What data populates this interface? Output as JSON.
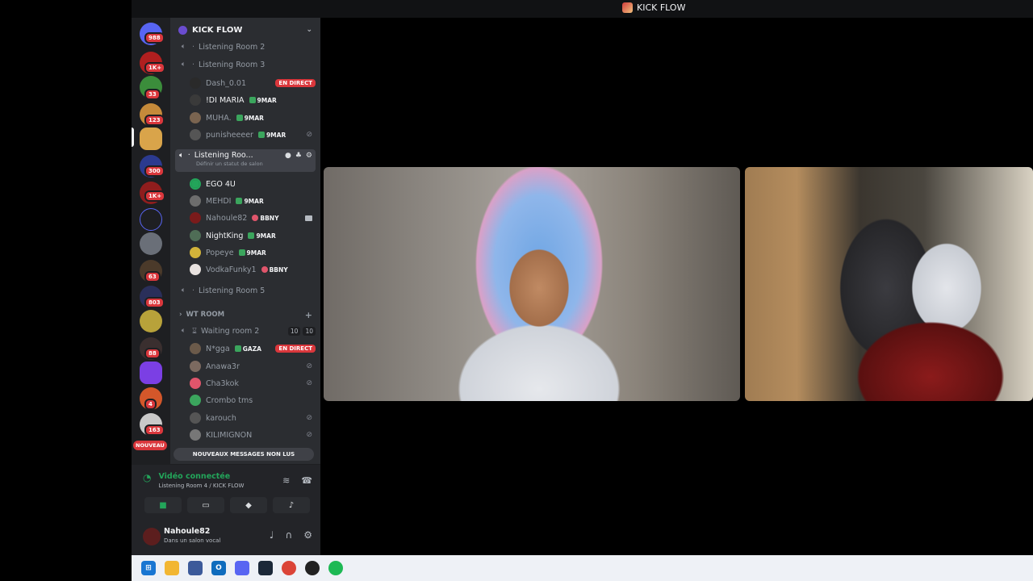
{
  "window": {
    "title": "KICK FLOW"
  },
  "rail": {
    "badges": [
      "988",
      "1K+",
      "33",
      "123",
      "300",
      "1K+",
      "63",
      "803",
      "88",
      "4",
      "163"
    ],
    "new_label": "NOUVEAU"
  },
  "guild": {
    "name": "KICK FLOW"
  },
  "channels": {
    "listening2": "Listening Room 2",
    "listening3": "Listening Room 3",
    "room3_users": [
      {
        "name": "Dash_0.01",
        "live": "EN DIRECT"
      },
      {
        "name": "!DI MARIA",
        "tag": "9MAR"
      },
      {
        "name": "MUHA.",
        "tag": "9MAR"
      },
      {
        "name": "punisheeeer",
        "tag": "9MAR"
      }
    ],
    "active": {
      "name": "Listening Roo...",
      "status_placeholder": "Définir un statut de salon"
    },
    "room4_users": [
      {
        "name": "EGO 4U"
      },
      {
        "name": "MEHDI",
        "tag": "9MAR"
      },
      {
        "name": "Nahoule82",
        "tag": "BBNY"
      },
      {
        "name": "NightKing",
        "tag": "9MAR"
      },
      {
        "name": "Popeye",
        "tag": "9MAR"
      },
      {
        "name": "VodkaFunky1",
        "tag": "BBNY"
      }
    ],
    "listening5": "Listening Room 5",
    "category": "WT ROOM",
    "waiting2": {
      "name": "Waiting room 2",
      "count_a": "10",
      "count_b": "10"
    },
    "waiting_users": [
      {
        "name": "N*gga",
        "tag": "GAZA",
        "live": "EN DIRECT"
      },
      {
        "name": "Anawa3r"
      },
      {
        "name": "Cha3kok"
      },
      {
        "name": "Crombo tms"
      },
      {
        "name": "karouch"
      },
      {
        "name": "KILIMIGNON"
      }
    ],
    "unread_banner": "NOUVEAUX MESSAGES NON LUS"
  },
  "voice": {
    "title": "Vidéo connectée",
    "subtitle": "Listening Room 4 / KICK FLOW"
  },
  "user": {
    "name": "Nahoule82",
    "status": "Dans un salon vocal"
  },
  "colors": {
    "accent_green": "#23a55a",
    "live_red": "#da373c",
    "panel": "#2b2d31",
    "rail": "#1e1f22"
  }
}
